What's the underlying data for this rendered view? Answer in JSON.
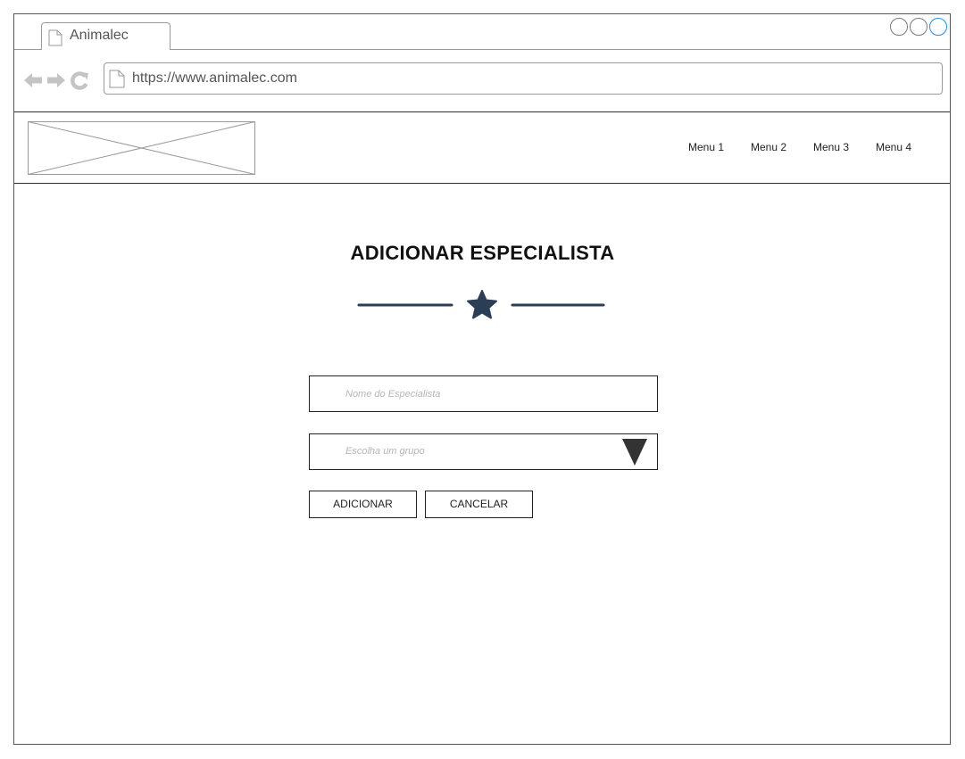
{
  "browser": {
    "tab_title": "Animalec",
    "url": "https://www.animalec.com"
  },
  "header": {
    "menu": [
      {
        "label": "Menu 1"
      },
      {
        "label": "Menu 2"
      },
      {
        "label": "Menu 3"
      },
      {
        "label": "Menu 4"
      }
    ]
  },
  "main": {
    "title": "ADICIONAR ESPECIALISTA",
    "ornament_icon": "star-icon",
    "name_field": {
      "placeholder": "Nome do Especialista",
      "value": ""
    },
    "group_select": {
      "placeholder": "Escolha um grupo"
    },
    "buttons": {
      "add_label": "ADICIONAR",
      "cancel_label": "CANCELAR"
    }
  },
  "colors": {
    "ornament": "#2c3e55",
    "accent_circle": "#1e90e0",
    "nav_icons": "#c4c4c4"
  }
}
